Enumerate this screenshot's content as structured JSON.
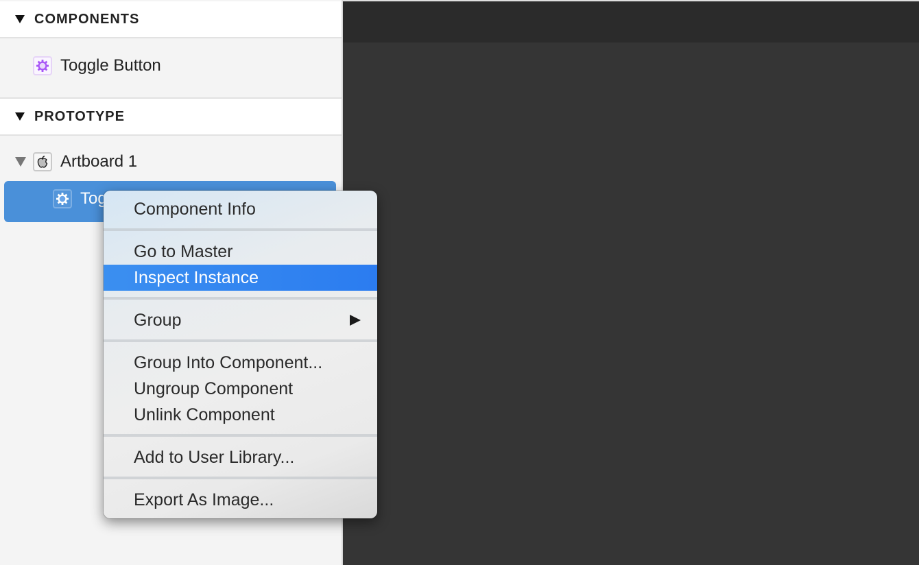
{
  "sidebar": {
    "sections": [
      {
        "title": "COMPONENTS",
        "expanded": true
      },
      {
        "title": "PROTOTYPE",
        "expanded": true
      }
    ],
    "components": [
      {
        "label": "Toggle Button",
        "icon": "gear-icon",
        "icon_color": "#a855f7"
      }
    ],
    "prototype": {
      "artboard": {
        "label": "Artboard 1",
        "icon": "apple-icon",
        "expanded": true
      },
      "children": [
        {
          "label": "Toggle Button",
          "visible_label": "Tog",
          "icon": "gear-icon",
          "selected": true
        }
      ]
    }
  },
  "context_menu": {
    "groups": [
      [
        {
          "label": "Component Info"
        }
      ],
      [
        {
          "label": "Go to Master"
        },
        {
          "label": "Inspect Instance",
          "highlighted": true
        }
      ],
      [
        {
          "label": "Group",
          "submenu": true
        }
      ],
      [
        {
          "label": "Group Into Component..."
        },
        {
          "label": "Ungroup Component"
        },
        {
          "label": "Unlink Component"
        }
      ],
      [
        {
          "label": "Add to User Library..."
        }
      ],
      [
        {
          "label": "Export As Image..."
        }
      ]
    ]
  },
  "colors": {
    "selection": "#4a90d9",
    "menu_highlight": "#2b7cf0",
    "canvas": "#353535",
    "component_purple": "#a855f7"
  }
}
